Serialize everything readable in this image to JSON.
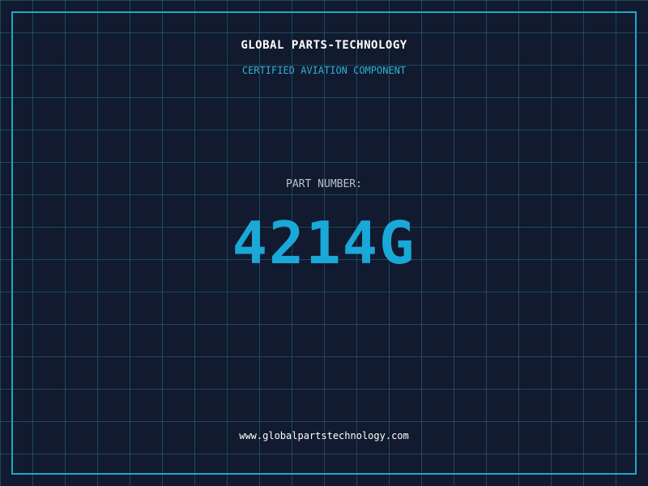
{
  "header": {
    "company": "GLOBAL PARTS-TECHNOLOGY",
    "subtitle": "CERTIFIED AVIATION COMPONENT"
  },
  "part": {
    "label": "PART NUMBER:",
    "number": "4214G"
  },
  "footer": {
    "website": "www.globalpartstechnology.com"
  },
  "colors": {
    "background": "#111a2e",
    "grid": "#266e87",
    "frame": "#1aa8cc",
    "accent": "#1aa8d8",
    "text": "#ffffff",
    "label": "#b9c2cf"
  }
}
